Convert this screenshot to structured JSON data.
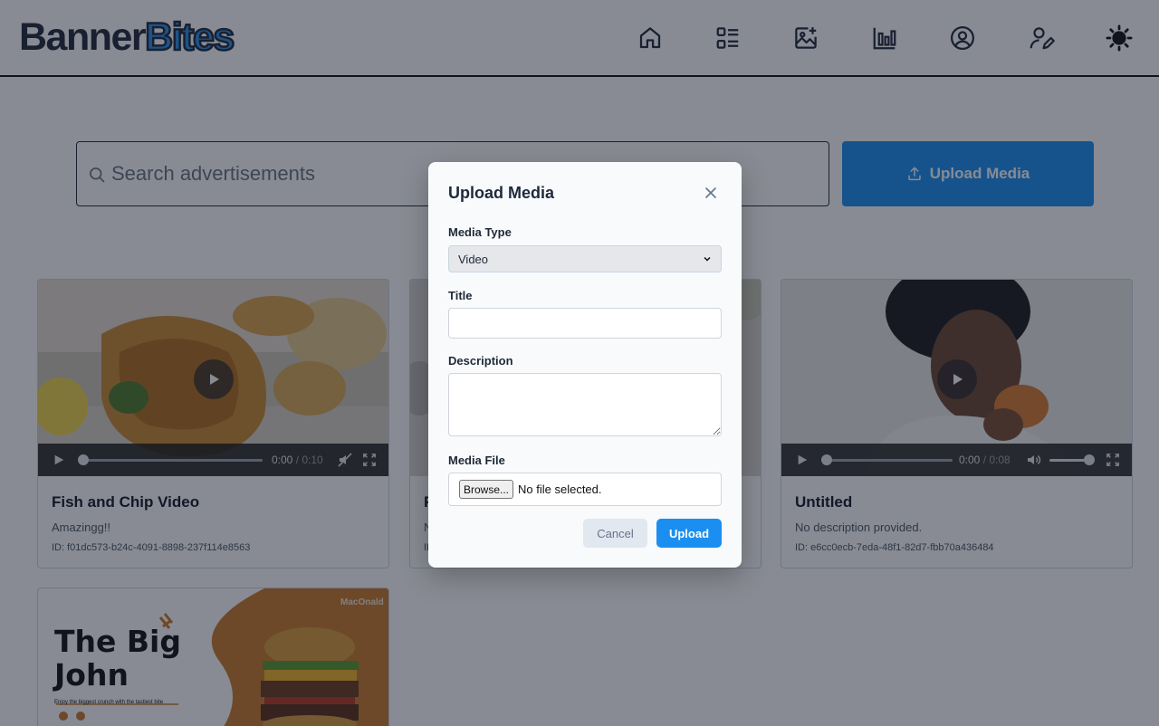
{
  "header": {
    "logo_part1": "Banner",
    "logo_part2": "Bites",
    "nav_icons": [
      "home-icon",
      "list-icon",
      "image-plus-icon",
      "bar-chart-icon",
      "user-circle-icon",
      "user-edit-icon",
      "sun-icon"
    ]
  },
  "search": {
    "placeholder": "Search advertisements"
  },
  "upload_button": {
    "label": "Upload Media"
  },
  "cards": [
    {
      "title": "Fish and Chip Video",
      "description": "Amazingg!!",
      "id_text": "ID: f01dc573-b24c-4091-8898-237f114e8563",
      "current_time": "0:00",
      "duration": "/ 0:10"
    },
    {
      "title": "F",
      "description": "N",
      "id_text": "ID"
    },
    {
      "title": "Untitled",
      "description": "No description provided.",
      "id_text": "ID: e6cc0ecb-7eda-48f1-82d7-fbb70a436484",
      "current_time": "0:00",
      "duration": "/ 0:08"
    },
    {
      "ad_brand": "MacOnald",
      "ad_headline_1": "The Big",
      "ad_headline_2": "John",
      "ad_tagline": "Enjoy the biggest crunch with the tastiest bite"
    }
  ],
  "modal": {
    "title": "Upload Media",
    "media_type_label": "Media Type",
    "media_type_value": "Video",
    "title_label": "Title",
    "title_value": "",
    "description_label": "Description",
    "description_value": "",
    "media_file_label": "Media File",
    "browse_label": "Browse...",
    "file_status": "No file selected.",
    "cancel_label": "Cancel",
    "upload_label": "Upload"
  },
  "colors": {
    "accent": "#1b8ff1",
    "logo_dark": "#1e293b",
    "ad_orange": "#c97a2b"
  }
}
